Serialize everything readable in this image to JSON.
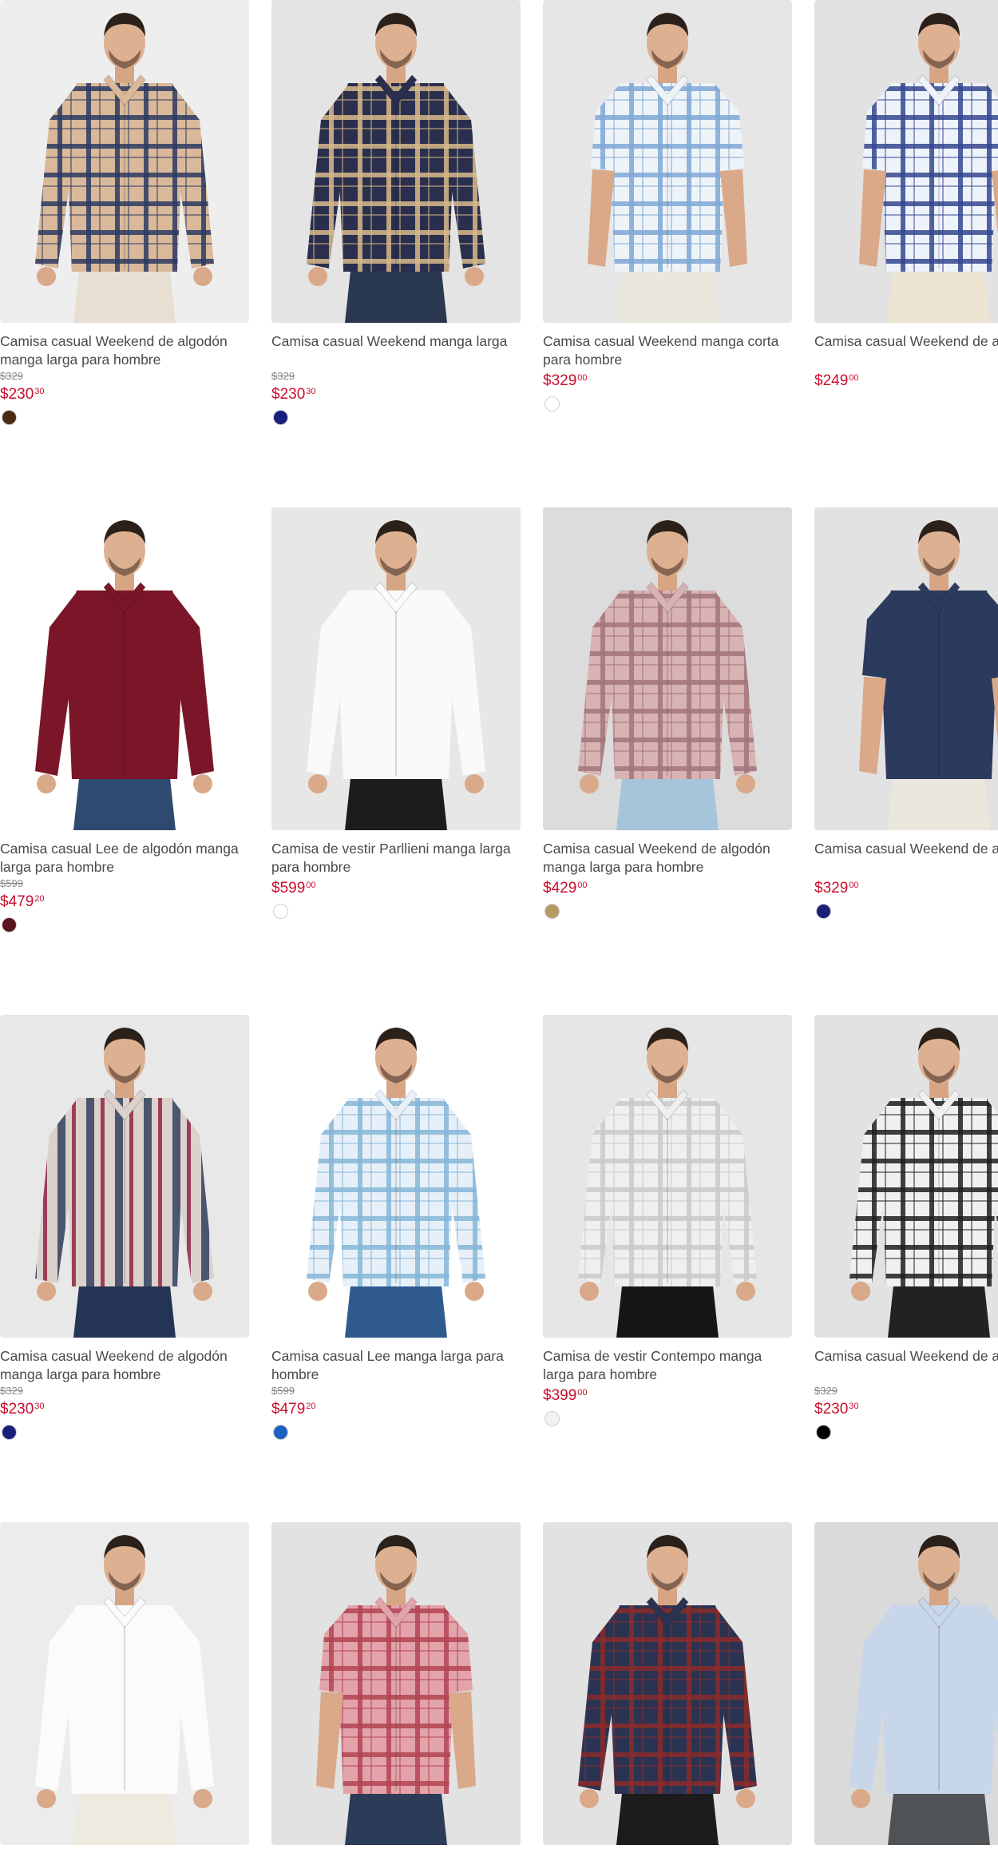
{
  "products": [
    {
      "name": "Camisa casual Weekend de algodón manga larga para hombre",
      "old_price": "$329",
      "price_int": "$230",
      "price_cents": "30",
      "swatch": "#4a2a10",
      "shirt": "#d9b99a",
      "stripe": "#2c3a63",
      "pants": "#e7e0d2",
      "bg": "#eeeeee",
      "style": "plaid",
      "sleeve": "long"
    },
    {
      "name": "Camisa casual Weekend manga larga",
      "old_price": "$329",
      "price_int": "$230",
      "price_cents": "30",
      "swatch": "#1a1f7a",
      "shirt": "#2b2f4e",
      "stripe": "#d8b98a",
      "pants": "#2a3850",
      "bg": "#e4e4e4",
      "style": "plaid",
      "sleeve": "long"
    },
    {
      "name": "Camisa casual Weekend manga corta para hombre",
      "old_price": "",
      "price_int": "$329",
      "price_cents": "00",
      "swatch": "#ffffff",
      "shirt": "#eef3f8",
      "stripe": "#7fa8d6",
      "pants": "#ece7dc",
      "bg": "#e6e6e6",
      "style": "plaid",
      "sleeve": "short"
    },
    {
      "name": "Camisa casual Weekend de algodón manga corta para hombre",
      "old_price": "",
      "price_int": "$249",
      "price_cents": "00",
      "swatch": "",
      "shirt": "#eef2fa",
      "stripe": "#34488f",
      "pants": "#ece3d2",
      "bg": "#e2e2e2",
      "style": "plaid",
      "sleeve": "short"
    },
    {
      "name": "Camisa casual Lee de algodón manga larga para hombre",
      "old_price": "$599",
      "price_int": "$479",
      "price_cents": "20",
      "swatch": "#5a1420",
      "shirt": "#7a1628",
      "stripe": "#7a1628",
      "pants": "#2e4a70",
      "bg": "#ffffff",
      "style": "solid",
      "sleeve": "long"
    },
    {
      "name": "Camisa de vestir Parllieni manga larga para hombre",
      "old_price": "",
      "price_int": "$599",
      "price_cents": "00",
      "swatch": "#ffffff",
      "shirt": "#fafafa",
      "stripe": "#fafafa",
      "pants": "#1c1c1c",
      "bg": "#e7e7e5",
      "style": "solid",
      "sleeve": "long"
    },
    {
      "name": "Camisa casual Weekend de algodón manga larga para hombre",
      "old_price": "",
      "price_int": "$429",
      "price_cents": "00",
      "swatch": "#b59a62",
      "shirt": "#d7b3b3",
      "stripe": "#a4747c",
      "pants": "#a6c4da",
      "bg": "#dcdcdc",
      "style": "plaid",
      "sleeve": "long"
    },
    {
      "name": "Camisa casual Weekend de algodón manga corta para hombre",
      "old_price": "",
      "price_int": "$329",
      "price_cents": "00",
      "swatch": "#1a1f7a",
      "shirt": "#2c3a5e",
      "stripe": "#2c3a5e",
      "pants": "#ece7dc",
      "bg": "#e2e2e2",
      "style": "solid",
      "sleeve": "short"
    },
    {
      "name": "Camisa casual Weekend de algodón manga larga para hombre",
      "old_price": "$329",
      "price_int": "$230",
      "price_cents": "30",
      "swatch": "#1a1f7a",
      "shirt": "#dcd2cc",
      "stripe": "#4b556e",
      "pants": "#233454",
      "bg": "#e8e8e8",
      "style": "stripes",
      "sleeve": "long"
    },
    {
      "name": "Camisa casual Lee manga larga para hombre",
      "old_price": "$599",
      "price_int": "$479",
      "price_cents": "20",
      "swatch": "#1f5fc0",
      "shirt": "#e7f0f8",
      "stripe": "#86b6d8",
      "pants": "#2e5a8e",
      "bg": "#ffffff",
      "style": "plaid",
      "sleeve": "long"
    },
    {
      "name": "Camisa de vestir Contempo manga larga para hombre",
      "old_price": "",
      "price_int": "$399",
      "price_cents": "00",
      "swatch": "#f2f2f2",
      "shirt": "#efefef",
      "stripe": "#c9c9c9",
      "pants": "#161616",
      "bg": "#e6e6e6",
      "style": "plaid",
      "sleeve": "long"
    },
    {
      "name": "Camisa casual Weekend de algodón manga larga para hombre",
      "old_price": "$329",
      "price_int": "$230",
      "price_cents": "30",
      "swatch": "#000000",
      "shirt": "#f0f0f0",
      "stripe": "#1e1e1e",
      "pants": "#222222",
      "bg": "#e2e2e2",
      "style": "plaid",
      "sleeve": "long"
    },
    {
      "name": "",
      "old_price": "",
      "price_int": "",
      "price_cents": "",
      "swatch": "",
      "shirt": "#fbfbfb",
      "stripe": "#fbfbfb",
      "pants": "#efeadf",
      "bg": "#ececec",
      "style": "solid",
      "sleeve": "long"
    },
    {
      "name": "",
      "old_price": "",
      "price_int": "",
      "price_cents": "",
      "swatch": "",
      "shirt": "#e2a3aa",
      "stripe": "#b34452",
      "pants": "#2c3b58",
      "bg": "#e2e2e2",
      "style": "plaid",
      "sleeve": "short"
    },
    {
      "name": "",
      "old_price": "",
      "price_int": "",
      "price_cents": "",
      "swatch": "",
      "shirt": "#2a3452",
      "stripe": "#8a2a2a",
      "pants": "#1c1c1c",
      "bg": "#e2e2e2",
      "style": "plaid",
      "sleeve": "long"
    },
    {
      "name": "",
      "old_price": "",
      "price_int": "",
      "price_cents": "",
      "swatch": "",
      "shirt": "#c8d6ea",
      "stripe": "#6f8cbf",
      "pants": "#505356",
      "bg": "#dadada",
      "style": "solid",
      "sleeve": "long"
    }
  ]
}
